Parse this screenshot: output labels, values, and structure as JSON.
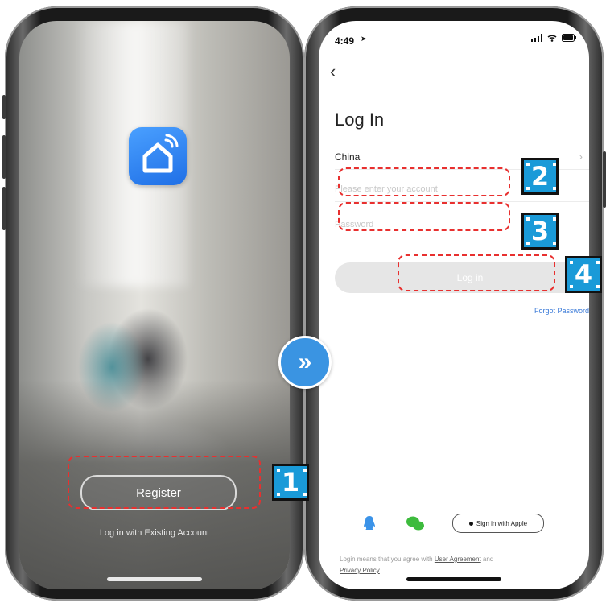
{
  "left_screen": {
    "register_label": "Register",
    "existing_account_label": "Log in with Existing Account"
  },
  "right_screen": {
    "status_time": "4:49",
    "title": "Log In",
    "country": "China",
    "account_placeholder": "Please enter your account",
    "password_placeholder": "Password",
    "login_label": "Log in",
    "forgot_password": "Forgot Password",
    "apple_label": "Sign in with Apple",
    "legal_prefix": "Login means that you agree with",
    "user_agreement": "User Agreement",
    "legal_and": "and",
    "privacy_policy": "Privacy Policy"
  },
  "annotations": {
    "step1": "1",
    "step2": "2",
    "step3": "3",
    "step4": "4",
    "arrow": "»"
  },
  "colors": {
    "accent_blue": "#1a9ad8",
    "annotation_red": "#e8302f",
    "link_blue": "#3a7ad8"
  },
  "icons": [
    "smart-home-app-icon",
    "back-chevron-icon",
    "chevron-right-icon",
    "qq-icon",
    "wechat-icon",
    "apple-icon",
    "signal-icon",
    "wifi-icon",
    "battery-icon",
    "next-arrow-icon"
  ]
}
